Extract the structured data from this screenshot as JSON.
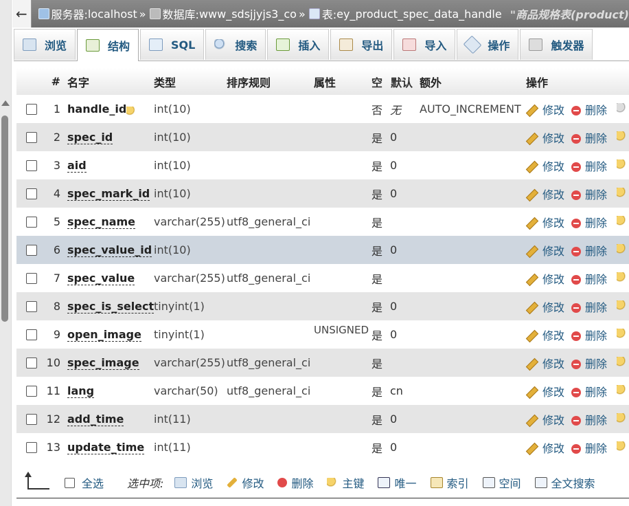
{
  "breadcrumb": {
    "back_label": "←",
    "server_label": "服务器:",
    "server": "localhost",
    "db_label": "数据库:",
    "db": "www_sdsjjyjs3_co",
    "table_label": "表:",
    "table": "ey_product_spec_data_handle",
    "comment": "\"商品规格表(product)",
    "sep": "»"
  },
  "tabs": [
    {
      "label": "浏览",
      "icon": "browse-icon"
    },
    {
      "label": "结构",
      "icon": "structure-icon"
    },
    {
      "label": "SQL",
      "icon": "sql-icon"
    },
    {
      "label": "搜索",
      "icon": "search-icon"
    },
    {
      "label": "插入",
      "icon": "insert-icon"
    },
    {
      "label": "导出",
      "icon": "export-icon"
    },
    {
      "label": "导入",
      "icon": "import-icon"
    },
    {
      "label": "操作",
      "icon": "operations-icon"
    },
    {
      "label": "触发器",
      "icon": "triggers-icon"
    }
  ],
  "headers": {
    "num": "#",
    "name": "名字",
    "type": "类型",
    "collation": "排序规则",
    "attributes": "属性",
    "null": "空",
    "default": "默认",
    "extra": "额外",
    "action": "操作"
  },
  "actions": {
    "edit": "修改",
    "drop": "删除"
  },
  "rows": [
    {
      "num": "1",
      "name": "handle_id",
      "type": "int(10)",
      "collation": "",
      "attributes": "",
      "null": "否",
      "default": "无",
      "extra": "AUTO_INCREMENT"
    },
    {
      "num": "2",
      "name": "spec_id",
      "type": "int(10)",
      "collation": "",
      "attributes": "",
      "null": "是",
      "default": "0",
      "extra": ""
    },
    {
      "num": "3",
      "name": "aid",
      "type": "int(10)",
      "collation": "",
      "attributes": "",
      "null": "是",
      "default": "0",
      "extra": ""
    },
    {
      "num": "4",
      "name": "spec_mark_id",
      "type": "int(10)",
      "collation": "",
      "attributes": "",
      "null": "是",
      "default": "0",
      "extra": ""
    },
    {
      "num": "5",
      "name": "spec_name",
      "type": "varchar(255)",
      "collation": "utf8_general_ci",
      "attributes": "",
      "null": "是",
      "default": "",
      "extra": ""
    },
    {
      "num": "6",
      "name": "spec_value_id",
      "type": "int(10)",
      "collation": "",
      "attributes": "",
      "null": "是",
      "default": "0",
      "extra": ""
    },
    {
      "num": "7",
      "name": "spec_value",
      "type": "varchar(255)",
      "collation": "utf8_general_ci",
      "attributes": "",
      "null": "是",
      "default": "",
      "extra": ""
    },
    {
      "num": "8",
      "name": "spec_is_select",
      "type": "tinyint(1)",
      "collation": "",
      "attributes": "",
      "null": "是",
      "default": "0",
      "extra": ""
    },
    {
      "num": "9",
      "name": "open_image",
      "type": "tinyint(1)",
      "collation": "",
      "attributes": "UNSIGNED",
      "null": "是",
      "default": "0",
      "extra": ""
    },
    {
      "num": "10",
      "name": "spec_image",
      "type": "varchar(255)",
      "collation": "utf8_general_ci",
      "attributes": "",
      "null": "是",
      "default": "",
      "extra": ""
    },
    {
      "num": "11",
      "name": "lang",
      "type": "varchar(50)",
      "collation": "utf8_general_ci",
      "attributes": "",
      "null": "是",
      "default": "cn",
      "extra": ""
    },
    {
      "num": "12",
      "name": "add_time",
      "type": "int(11)",
      "collation": "",
      "attributes": "",
      "null": "是",
      "default": "0",
      "extra": ""
    },
    {
      "num": "13",
      "name": "update_time",
      "type": "int(11)",
      "collation": "",
      "attributes": "",
      "null": "是",
      "default": "0",
      "extra": ""
    }
  ],
  "footer": {
    "select_all": "全选",
    "with_selected": "选中项:",
    "items": [
      {
        "label": "浏览",
        "icon": "browse-icon"
      },
      {
        "label": "修改",
        "icon": "edit-icon"
      },
      {
        "label": "删除",
        "icon": "drop-icon"
      },
      {
        "label": "主键",
        "icon": "primary-key-icon"
      },
      {
        "label": "唯一",
        "icon": "unique-icon"
      },
      {
        "label": "索引",
        "icon": "index-icon"
      },
      {
        "label": "空间",
        "icon": "spatial-icon"
      },
      {
        "label": "全文搜索",
        "icon": "fulltext-icon"
      }
    ]
  }
}
